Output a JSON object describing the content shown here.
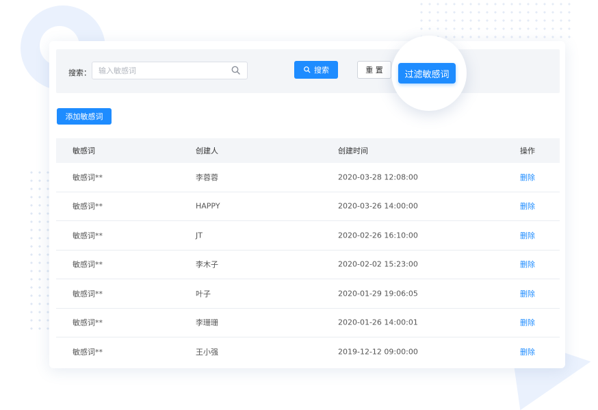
{
  "search": {
    "label": "搜索：",
    "placeholder": "输入敏感词",
    "value": "",
    "search_button": "搜索",
    "reset_button": "重 置"
  },
  "actions": {
    "add_button": "添加敏感词",
    "filter_button": "过滤敏感词"
  },
  "table": {
    "headers": [
      "敏感词",
      "创建人",
      "创建时间",
      "操作"
    ],
    "rows": [
      {
        "word": "敏感词**",
        "creator": "李蓉蓉",
        "time": "2020-03-28 12:08:00",
        "action": "删除"
      },
      {
        "word": "敏感词**",
        "creator": "HAPPY",
        "time": "2020-03-26 14:00:00",
        "action": "删除"
      },
      {
        "word": "敏感词**",
        "creator": "JT",
        "time": "2020-02-26 16:10:00",
        "action": "删除"
      },
      {
        "word": "敏感词**",
        "creator": "李木子",
        "time": "2020-02-02 15:23:00",
        "action": "删除"
      },
      {
        "word": "敏感词**",
        "creator": "叶子",
        "time": "2020-01-29 19:06:05",
        "action": "删除"
      },
      {
        "word": "敏感词**",
        "creator": "李珊珊",
        "time": "2020-01-26 14:00:01",
        "action": "删除"
      },
      {
        "word": "敏感词**",
        "creator": "王小强",
        "time": "2019-12-12 09:00:00",
        "action": "删除"
      }
    ]
  },
  "colors": {
    "primary": "#1e8cff",
    "panel_bg": "#f3f5f8"
  },
  "icons": {
    "search_input": "search-icon",
    "search_button": "search-icon"
  }
}
